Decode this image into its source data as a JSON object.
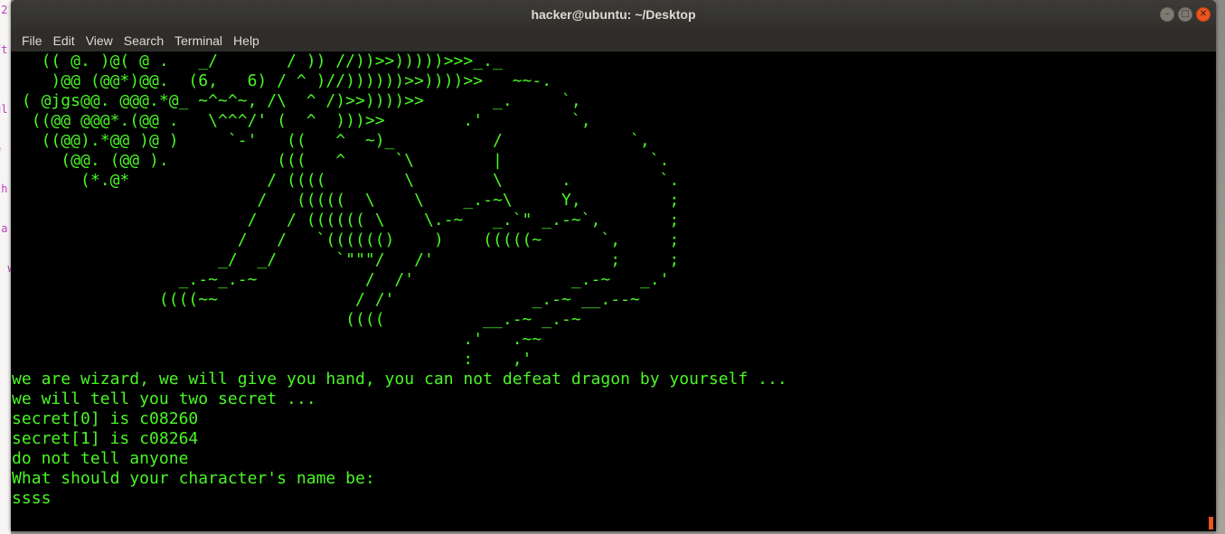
{
  "window": {
    "title": "hacker@ubuntu: ~/Desktop"
  },
  "menubar": {
    "items": [
      "File",
      "Edit",
      "View",
      "Search",
      "Terminal",
      "Help"
    ]
  },
  "terminal": {
    "ascii_art": "   (( @. )@( @ .   _/       / )) //))>>)))))>>>_._\n    )@@ (@@*)@@.  (6,   6) / ^ )//))))))>>))))>>   ~~-.\n ( @jgs@@. @@@.*@_ ~^~^~, /\\  ^ /)>>))))>>       _.     `,\n  ((@@ @@@*.(@@ .   \\^^^/' (  ^  )))>>        .'         `,\n   ((@@).*@@ )@ )     `-'   ((   ^  ~)_          /             `,\n     (@@. (@@ ).           (((   ^     `\\        |               `.\n       (*.@*              / ((((        \\        \\      .         `.\n                         /   (((((  \\    \\    _.-~\\     Y,         ;\n                        /   / (((((( \\    \\.-~   _.`\" _.-~`,       ;\n                       /   /   `(((((()    )    (((((~      `,     ;\n                     _/  _/      `\"\"\"/   /'                  ;     ;\n                 _.-~_.-~           /  /'                _.-~   _.'\n               ((((~~              / /'              _.-~ __.--~\n                                  ((((          __.-~ _.-~\n                                              .'   .~~\n                                              :    ,'",
    "output": "we are wizard, we will give you hand, you can not defeat dragon by yourself ...\nwe will tell you two secret ...\nsecret[0] is c08260\nsecret[1] is c08264\ndo not tell anyone\nWhat should your character's name be:\nssss"
  },
  "background_fragments": ".2\n\"\nft\n]\n)\nul\n\ne\n\nth\n\n a\n\n  w"
}
